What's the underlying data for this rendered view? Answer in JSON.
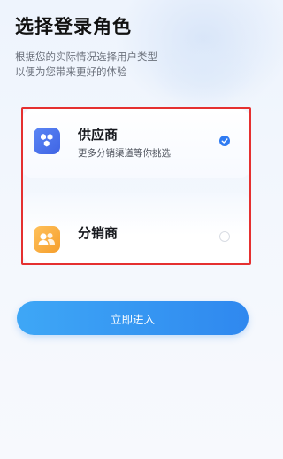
{
  "header": {
    "title": "选择登录角色",
    "subtitle_line1": "根据您的实际情况选择用户类型",
    "subtitle_line2": "以便为您带来更好的体验"
  },
  "roles": [
    {
      "name": "供应商",
      "description": "更多分销渠道等你挑选",
      "icon": "hexagons-icon",
      "selected": true,
      "icon_color": "#4a74ee"
    },
    {
      "name": "分销商",
      "description": "",
      "icon": "people-group-icon",
      "selected": false,
      "icon_color": "#f7a83a"
    }
  ],
  "actions": {
    "enter_label": "立即进入"
  },
  "colors": {
    "accent": "#2f7bf2",
    "highlight_border": "#e53030"
  }
}
